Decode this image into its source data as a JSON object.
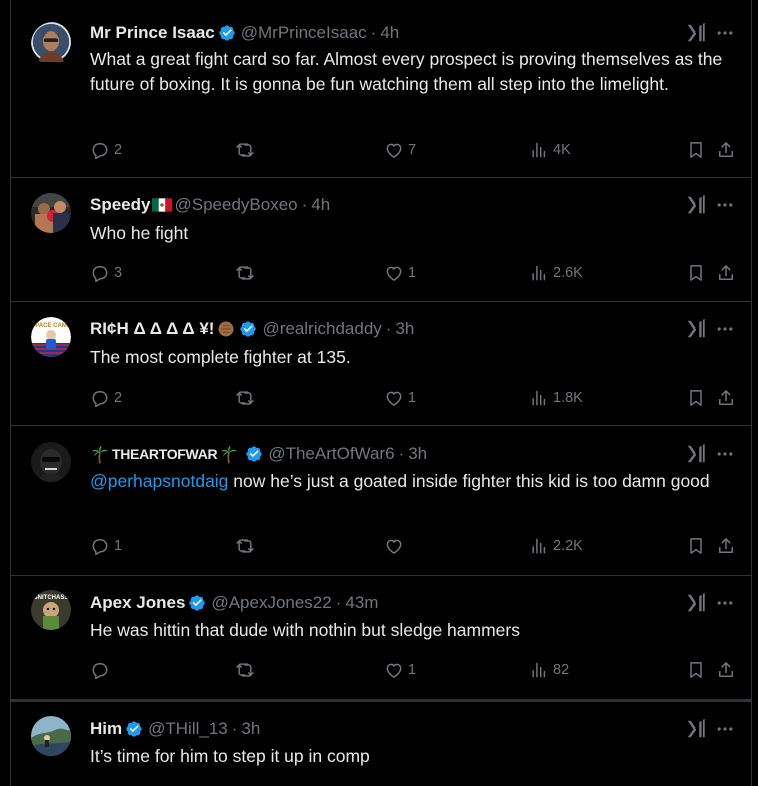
{
  "tweets": [
    {
      "name": "Mr Prince Isaac",
      "verified": true,
      "handle": "@MrPrinceIsaac",
      "time": "4h",
      "text": "What a great fight card so far. Almost every prospect is proving themselves as the future of boxing. It is gonna be fun watching them all step into the limelight.",
      "replies": "2",
      "reposts": "",
      "likes": "7",
      "views": "4K"
    },
    {
      "name": "Speedy",
      "verified": false,
      "handle": "@SpeedyBoxeo",
      "time": "4h",
      "text": "Who he fight",
      "replies": "3",
      "reposts": "",
      "likes": "1",
      "views": "2.6K"
    },
    {
      "name": "RI¢H Δ Δ Δ Δ ¥!",
      "verified": true,
      "handle": "@realrichdaddy",
      "time": "3h",
      "text": "The most complete fighter at 135.",
      "replies": "2",
      "reposts": "",
      "likes": "1",
      "views": "1.8K"
    },
    {
      "name": "THEARTOFWAR",
      "verified": true,
      "handle": "@TheArtOfWar6",
      "time": "3h",
      "mention": "@perhapsnotdaig",
      "text": " now he’s just a goated inside fighter this kid is too damn good",
      "replies": "1",
      "reposts": "",
      "likes": "",
      "views": "2.2K"
    },
    {
      "name": "Apex Jones",
      "verified": true,
      "handle": "@ApexJones22",
      "time": "43m",
      "text": "He was hittin that dude with nothin but sledge hammers",
      "replies": "",
      "reposts": "",
      "likes": "1",
      "views": "82"
    },
    {
      "name": "Him",
      "verified": true,
      "handle": "@THill_13",
      "time": "3h",
      "text": "It’s time for him to step it up in comp"
    }
  ],
  "avatar_badges": {
    "space_camp": "SPACE CAMP",
    "snitch": "SNITCHASS"
  },
  "colors": {
    "background": "#000000",
    "text": "#e7e9ea",
    "muted": "#71767b",
    "accent": "#1d9bf0",
    "border": "#2f3336"
  },
  "icons": [
    "verified-badge-icon",
    "grok-icon",
    "more-icon",
    "reply-icon",
    "repost-icon",
    "like-icon",
    "views-icon",
    "bookmark-icon",
    "share-icon",
    "mexico-flag-icon",
    "palm-tree-icon",
    "hands-emoji-icon"
  ]
}
